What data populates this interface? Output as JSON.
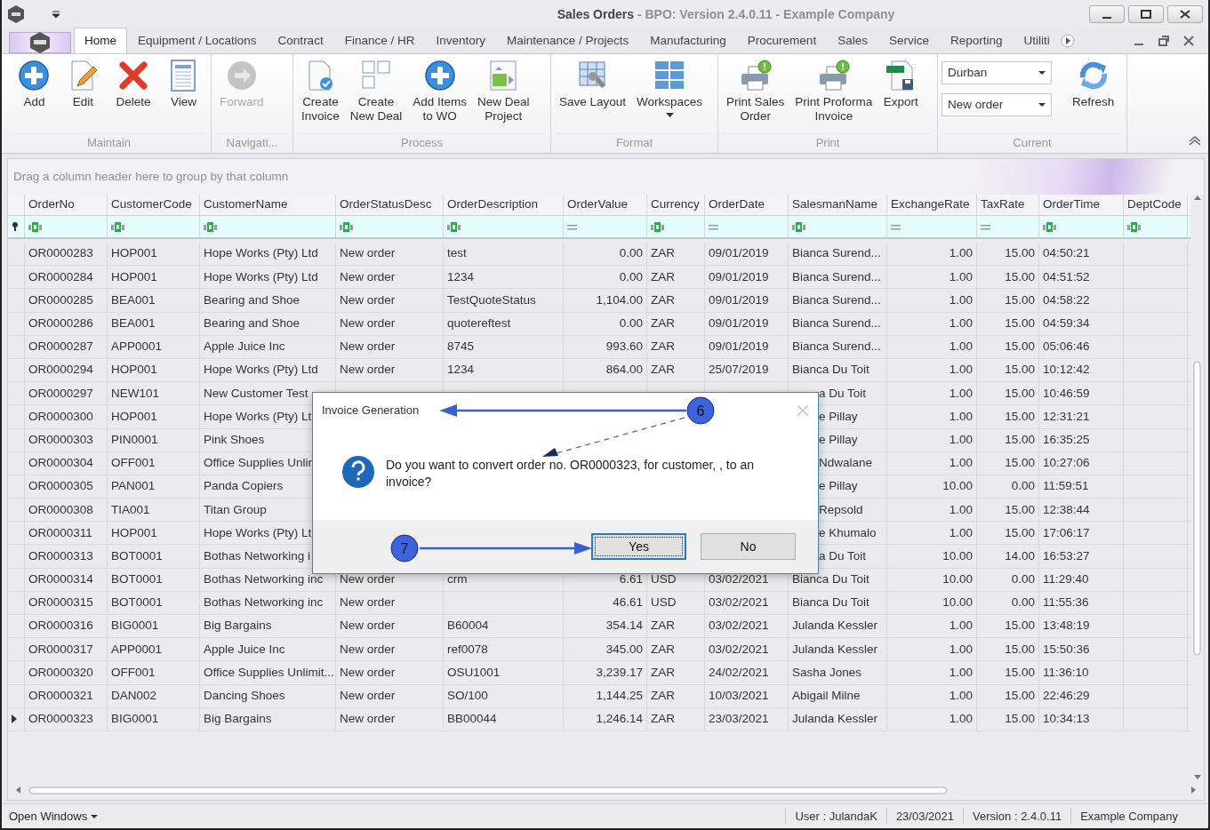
{
  "window": {
    "title": "Sales Orders",
    "subtitle": " - BPO: Version 2.4.0.11 - Example Company"
  },
  "ribbon_tabs": [
    {
      "label": "Home",
      "selected": true
    },
    {
      "label": "Equipment / Locations",
      "selected": false
    },
    {
      "label": "Contract",
      "selected": false
    },
    {
      "label": "Finance / HR",
      "selected": false
    },
    {
      "label": "Inventory",
      "selected": false
    },
    {
      "label": "Maintenance / Projects",
      "selected": false
    },
    {
      "label": "Manufacturing",
      "selected": false
    },
    {
      "label": "Procurement",
      "selected": false
    },
    {
      "label": "Sales",
      "selected": false
    },
    {
      "label": "Service",
      "selected": false
    },
    {
      "label": "Reporting",
      "selected": false
    },
    {
      "label": "Utiliti",
      "selected": false
    }
  ],
  "ribbon_groups": [
    {
      "title": "Maintain",
      "items": [
        {
          "kind": "add",
          "label": "Add",
          "disabled": false,
          "menu": false
        },
        {
          "kind": "edit",
          "label": "Edit",
          "disabled": false,
          "menu": false
        },
        {
          "kind": "delete",
          "label": "Delete",
          "disabled": false,
          "menu": false
        },
        {
          "kind": "view",
          "label": "View",
          "disabled": false,
          "menu": false
        }
      ]
    },
    {
      "title": "Navigati...",
      "items": [
        {
          "kind": "forward",
          "label": "Forward",
          "disabled": true,
          "menu": false
        }
      ]
    },
    {
      "title": "Process",
      "items": [
        {
          "kind": "invoice",
          "label": "Create\nInvoice",
          "disabled": false,
          "menu": false
        },
        {
          "kind": "deal",
          "label": "Create\nNew Deal",
          "disabled": false,
          "menu": false
        },
        {
          "kind": "add",
          "label": "Add Items\nto WO",
          "disabled": false,
          "menu": false
        },
        {
          "kind": "project",
          "label": "New Deal\nProject",
          "disabled": false,
          "menu": false
        }
      ]
    },
    {
      "title": "Format",
      "items": [
        {
          "kind": "layout",
          "label": "Save Layout",
          "disabled": false,
          "menu": false
        },
        {
          "kind": "workspaces",
          "label": "Workspaces",
          "disabled": false,
          "menu": true
        }
      ]
    },
    {
      "title": "Print",
      "items": [
        {
          "kind": "print",
          "label": "Print Sales\nOrder",
          "disabled": false,
          "menu": false
        },
        {
          "kind": "print",
          "label": "Print Proforma\nInvoice",
          "disabled": false,
          "menu": false
        },
        {
          "kind": "export",
          "label": "Export",
          "disabled": false,
          "menu": false
        }
      ]
    },
    {
      "title": "Current",
      "fields": [
        {
          "value": "Durban"
        },
        {
          "value": "New order"
        }
      ],
      "items": [
        {
          "kind": "refresh",
          "label": "Refresh",
          "disabled": false,
          "menu": false
        }
      ]
    }
  ],
  "grid": {
    "group_panel_hint": "Drag a column header here to group by that column",
    "columns": [
      {
        "title": "OrderNo",
        "kind": "text"
      },
      {
        "title": "CustomerCode",
        "kind": "text"
      },
      {
        "title": "CustomerName",
        "kind": "text"
      },
      {
        "title": "OrderStatusDesc",
        "kind": "text"
      },
      {
        "title": "OrderDescription",
        "kind": "text"
      },
      {
        "title": "OrderValue",
        "kind": "number"
      },
      {
        "title": "Currency",
        "kind": "text"
      },
      {
        "title": "OrderDate",
        "kind": "date"
      },
      {
        "title": "SalesmanName",
        "kind": "text"
      },
      {
        "title": "ExchangeRate",
        "kind": "number"
      },
      {
        "title": "TaxRate",
        "kind": "number"
      },
      {
        "title": "OrderTime",
        "kind": "text"
      },
      {
        "title": "DeptCode",
        "kind": "text"
      }
    ],
    "rows": [
      {
        "current": false,
        "cells": [
          "OR0000283",
          "HOP001",
          "Hope Works (Pty) Ltd",
          "New order",
          "test",
          "0.00",
          "ZAR",
          "09/01/2019",
          "Bianca Surend...",
          "1.00",
          "15.00",
          "04:50:21",
          null
        ]
      },
      {
        "current": false,
        "cells": [
          "OR0000284",
          "HOP001",
          "Hope Works (Pty) Ltd",
          "New order",
          "1234",
          "0.00",
          "ZAR",
          "09/01/2019",
          "Bianca Surend...",
          "1.00",
          "15.00",
          "04:51:52",
          null
        ]
      },
      {
        "current": false,
        "cells": [
          "OR0000285",
          "BEA001",
          "Bearing and Shoe",
          "New order",
          "TestQuoteStatus",
          "1,104.00",
          "ZAR",
          "09/01/2019",
          "Bianca Surend...",
          "1.00",
          "15.00",
          "04:58:22",
          null
        ]
      },
      {
        "current": false,
        "cells": [
          "OR0000286",
          "BEA001",
          "Bearing and Shoe",
          "New order",
          "quotereftest",
          "0.00",
          "ZAR",
          "09/01/2019",
          "Bianca Surend...",
          "1.00",
          "15.00",
          "04:59:34",
          null
        ]
      },
      {
        "current": false,
        "cells": [
          "OR0000287",
          "APP0001",
          "Apple Juice Inc",
          "New order",
          "8745",
          "993.60",
          "ZAR",
          "09/01/2019",
          "Bianca Surend...",
          "1.00",
          "15.00",
          "05:06:46",
          null
        ]
      },
      {
        "current": false,
        "cells": [
          "OR0000294",
          "HOP001",
          "Hope Works (Pty) Ltd",
          "New order",
          "1234",
          "864.00",
          "ZAR",
          "25/07/2019",
          "Bianca Du Toit",
          "1.00",
          "15.00",
          "10:12:42",
          null
        ]
      },
      {
        "current": false,
        "cells": [
          "OR0000297",
          "NEW101",
          "New Customer Test",
          null,
          null,
          null,
          null,
          null,
          "a Du Toit",
          "1.00",
          "15.00",
          "10:46:59",
          null
        ]
      },
      {
        "current": false,
        "cells": [
          "OR0000300",
          "HOP001",
          "Hope Works (Pty) Lt",
          null,
          null,
          null,
          null,
          null,
          "e Pillay",
          "1.00",
          "15.00",
          "12:31:21",
          null
        ]
      },
      {
        "current": false,
        "cells": [
          "OR0000303",
          "PIN0001",
          "Pink Shoes",
          null,
          null,
          null,
          null,
          null,
          "e Pillay",
          "1.00",
          "15.00",
          "16:35:25",
          null
        ]
      },
      {
        "current": false,
        "cells": [
          "OR0000304",
          "OFF001",
          "Office Supplies Unlin",
          null,
          null,
          null,
          null,
          null,
          "Ndwalane",
          "1.00",
          "15.00",
          "10:27:06",
          null
        ]
      },
      {
        "current": false,
        "cells": [
          "OR0000305",
          "PAN001",
          "Panda Copiers",
          null,
          null,
          null,
          null,
          null,
          "e Pillay",
          "10.00",
          "0.00",
          "11:59:51",
          null
        ]
      },
      {
        "current": false,
        "cells": [
          "OR0000308",
          "TIA001",
          "Titan Group",
          null,
          null,
          null,
          null,
          null,
          "Repsold",
          "1.00",
          "15.00",
          "12:38:44",
          null
        ]
      },
      {
        "current": false,
        "cells": [
          "OR0000311",
          "HOP001",
          "Hope Works (Pty) Lt",
          null,
          null,
          null,
          null,
          null,
          "e Khumalo",
          "1.00",
          "15.00",
          "17:06:17",
          null
        ]
      },
      {
        "current": false,
        "cells": [
          "OR0000313",
          "BOT0001",
          "Bothas Networking i",
          null,
          null,
          null,
          null,
          null,
          "a Du Toit",
          "10.00",
          "14.00",
          "16:53:27",
          null
        ]
      },
      {
        "current": false,
        "cells": [
          "OR0000314",
          "BOT0001",
          "Bothas Networking inc",
          "New order",
          "crm",
          "6.61",
          "USD",
          "03/02/2021",
          "Bianca Du Toit",
          "10.00",
          "0.00",
          "11:29:40",
          null
        ]
      },
      {
        "current": false,
        "cells": [
          "OR0000315",
          "BOT0001",
          "Bothas Networking inc",
          "New order",
          null,
          "46.61",
          "USD",
          "03/02/2021",
          "Bianca Du Toit",
          "10.00",
          "0.00",
          "11:55:36",
          null
        ]
      },
      {
        "current": false,
        "cells": [
          "OR0000316",
          "BIG0001",
          "Big Bargains",
          "New order",
          "B60004",
          "354.14",
          "ZAR",
          "03/02/2021",
          "Julanda Kessler",
          "1.00",
          "15.00",
          "13:48:19",
          null
        ]
      },
      {
        "current": false,
        "cells": [
          "OR0000317",
          "APP0001",
          "Apple Juice Inc",
          "New order",
          "ref0078",
          "345.00",
          "ZAR",
          "03/02/2021",
          "Julanda Kessler",
          "1.00",
          "15.00",
          "15:50:36",
          null
        ]
      },
      {
        "current": false,
        "cells": [
          "OR0000320",
          "OFF001",
          "Office Supplies Unlimit...",
          "New order",
          "OSU1001",
          "3,239.17",
          "ZAR",
          "24/02/2021",
          "Sasha Jones",
          "1.00",
          "15.00",
          "11:36:10",
          null
        ]
      },
      {
        "current": false,
        "cells": [
          "OR0000321",
          "DAN002",
          "Dancing Shoes",
          "New order",
          "SO/100",
          "1,144.25",
          "ZAR",
          "10/03/2021",
          "Abigail Milne",
          "1.00",
          "15.00",
          "22:46:29",
          null
        ]
      },
      {
        "current": true,
        "cells": [
          "OR0000323",
          "BIG0001",
          "Big Bargains",
          "New order",
          "BB00044",
          "1,246.14",
          "ZAR",
          "23/03/2021",
          "Julanda Kessler",
          "1.00",
          "15.00",
          "10:34:13",
          null
        ]
      }
    ]
  },
  "dialog": {
    "title": "Invoice Generation",
    "message": "Do you want to convert order no. OR0000323, for customer, , to an invoice?",
    "buttons": [
      {
        "label": "Yes",
        "focused": true
      },
      {
        "label": "No",
        "focused": false
      }
    ]
  },
  "annotations": [
    {
      "number": "6"
    },
    {
      "number": "7"
    }
  ],
  "status_bar": {
    "menu": "Open Windows",
    "items": [
      "User : JulandaK",
      "23/03/2021",
      "Version : 2.4.0.11",
      "Example Company"
    ]
  }
}
